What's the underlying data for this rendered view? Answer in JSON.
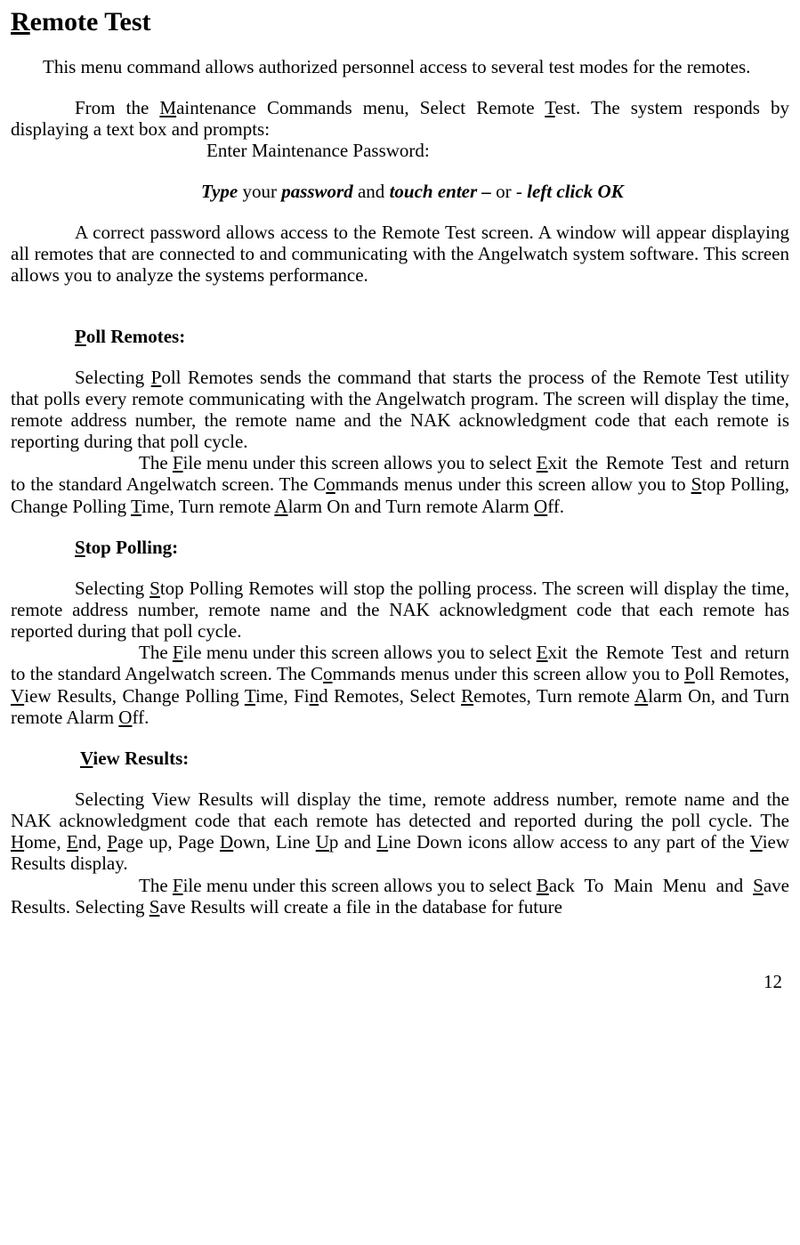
{
  "title": {
    "underline": "R",
    "rest": "emote Test"
  },
  "intro": "This menu command allows authorized personnel access to several test modes for the remotes.",
  "from": {
    "pre": "From the ",
    "m_u": "M",
    "m_rest": "aintenance Commands menu, Select Remote ",
    "t_u": "T",
    "t_rest": "est. The system responds by displaying a text box and prompts:"
  },
  "prompt": "Enter Maintenance Password:",
  "instruction": {
    "type": "Type",
    "sp1": " your ",
    "password": "password",
    "sp2": " and ",
    "touch": "touch enter –",
    "or": " or -  ",
    "click": "left click OK"
  },
  "correct": "A correct password allows access to the Remote Test screen. A window will appear displaying all remotes that are connected to and communicating with the Angelwatch system software. This screen allows you to analyze the systems performance.",
  "poll": {
    "head_u": "P",
    "head_rest": "oll Remotes:",
    "p1_a": "Selecting ",
    "p1_u": "P",
    "p1_b": "oll Remotes sends the command that starts the process of the Remote Test utility that polls every remote communicating with the Angelwatch program. The screen will display the time, remote address number, the remote name and the NAK acknowledgment code that each remote is reporting during that poll cycle.",
    "f1": "The ",
    "f_u": "F",
    "f2": "ile menu under this screen allows you to select ",
    "e_u": "E",
    "f3": "xit the Remote Test and return to the standard Angelwatch screen. The C",
    "o_u": "o",
    "f4": "mmands menus under this screen allow you to ",
    "s_u": "S",
    "f5": "top Polling, Change Polling ",
    "t_u": "T",
    "f6": "ime, Turn remote ",
    "a_u": "A",
    "f7": "larm On and Turn remote Alarm ",
    "off_u": "O",
    "f8": "ff."
  },
  "stop": {
    "head_u": "S",
    "head_rest": "top Polling:",
    "p1_a": "Selecting ",
    "p1_u": "S",
    "p1_b": "top Polling Remotes will stop the polling process. The screen will display the time, remote address number, remote name and the NAK acknowledgment code that each remote has reported during that poll cycle.",
    "f1": "The ",
    "f_u": "F",
    "f2": "ile menu under this screen allows you to select ",
    "e_u": "E",
    "f3": "xit the Remote Test and return to the standard Angelwatch screen. The C",
    "o_u": "o",
    "f4": "mmands menus under this screen allow you to ",
    "p_u": "P",
    "f5": "oll Remotes, ",
    "v_u": "V",
    "f6": "iew Results, Change Polling ",
    "t_u": "T",
    "f7": "ime, Fi",
    "n_u": "n",
    "f8": "d Remotes, Select ",
    "r_u": "R",
    "f9": "emotes, Turn remote ",
    "a_u": "A",
    "f10": "larm On, and Turn remote Alarm ",
    "off_u": "O",
    "f11": "ff."
  },
  "view": {
    "head_u": "V",
    "head_rest": "iew Results:",
    "p1_a": "Selecting View Results will display the time, remote address number, remote name and the NAK acknowledgment code that each remote has detected and reported during the poll cycle. The ",
    "h_u": "H",
    "p1_b": "ome, ",
    "end_u": "E",
    "p1_c": "nd, ",
    "page_u": "P",
    "p1_d": "age up, Page ",
    "d_u": "D",
    "p1_e": "own, Line ",
    "u_u": "U",
    "p1_f": "p and ",
    "l_u": "L",
    "p1_g": "ine Down icons allow access to any part of the ",
    "v_u": "V",
    "p1_h": "iew Results display.",
    "f1": "The ",
    "f_u": "F",
    "f2": "ile menu under this screen allows you to select ",
    "b_u": "B",
    "f3": "ack To Main Menu and ",
    "s_u": "S",
    "f4": "ave Results. Selecting ",
    "s2_u": "S",
    "f5": "ave Results will create a file in the database for future"
  },
  "page_number": "12"
}
